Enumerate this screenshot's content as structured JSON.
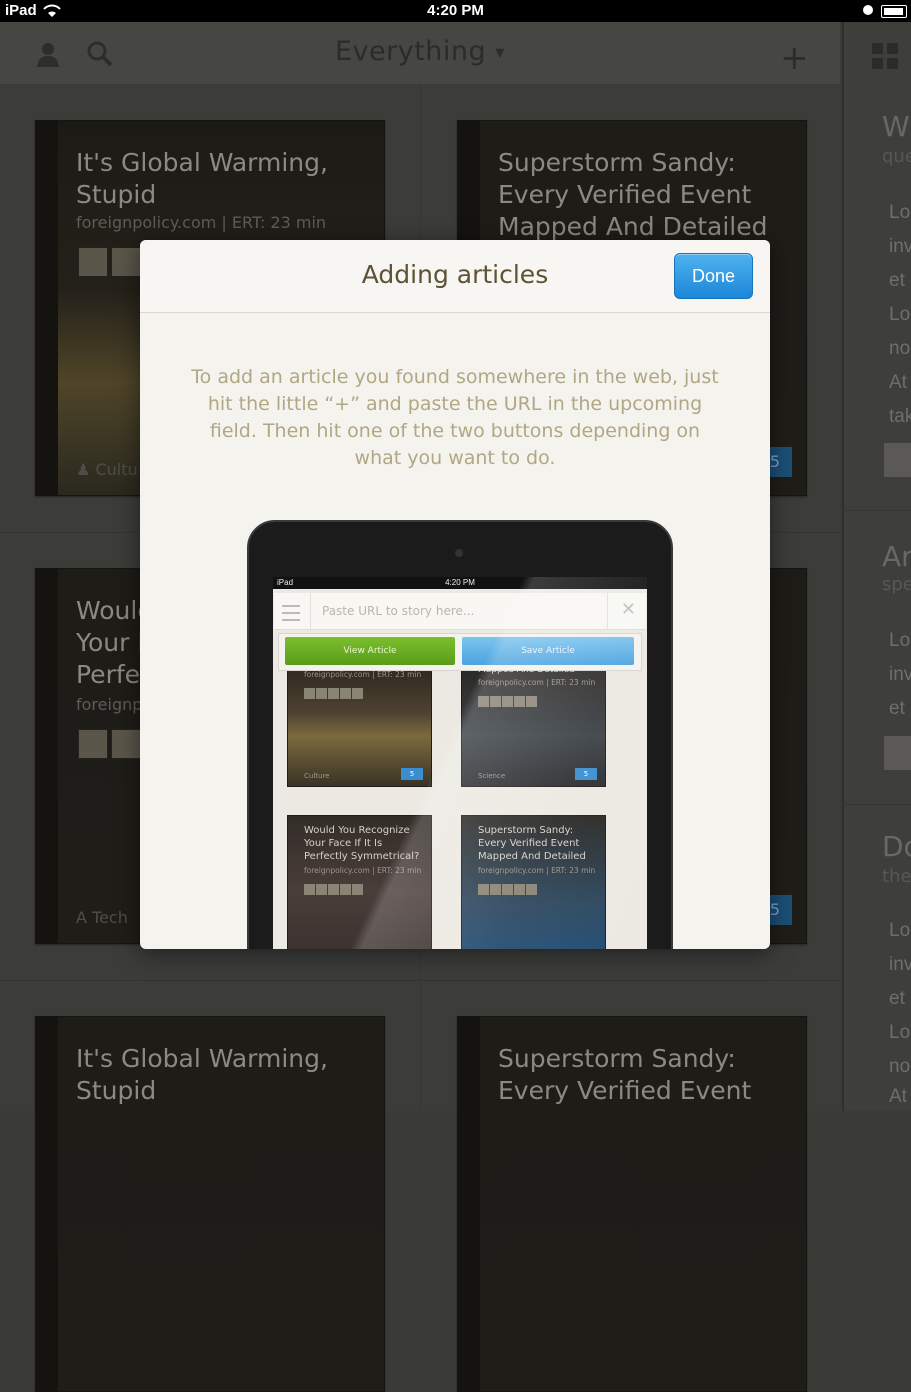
{
  "status_bar": {
    "carrier": "iPad",
    "time": "4:20 PM"
  },
  "top_bar": {
    "title": "Everything"
  },
  "feed": {
    "cards": [
      {
        "title": "It's Global Warming, Stupid",
        "source": "foreignpolicy.com | ERT: 23 min",
        "category": "Cultu"
      },
      {
        "title": "Superstorm Sandy: Every Verified Event Mapped And Detailed",
        "badge": "5"
      },
      {
        "title": "Would Your I Perfe",
        "source": "foreignp",
        "category": "Tech"
      },
      {
        "badge": "5"
      },
      {
        "title": "It's Global Warming, Stupid"
      },
      {
        "title": "Superstorm Sandy: Every Verified Event"
      }
    ]
  },
  "side_panel": {
    "items": [
      {
        "heading": "W",
        "sub": "que",
        "lines": [
          "Lo",
          "inv",
          "et",
          "Lo",
          "no",
          "At",
          "tak"
        ]
      },
      {
        "heading": "Ar",
        "sub": "spe",
        "lines": [
          "Lo",
          "inv",
          "et"
        ]
      },
      {
        "heading": "Do",
        "sub": "the",
        "lines": [
          "Lo",
          "inv",
          "et",
          "Lo",
          "no",
          "At"
        ]
      }
    ]
  },
  "modal": {
    "title": "Adding articles",
    "done_label": "Done",
    "instructions": "To add an article you found somewhere in the web, just hit the little “+” and paste the URL in the upcoming field. Then hit one of the two buttons depending on what you want to do."
  },
  "illustration": {
    "status": {
      "carrier": "iPad",
      "time": "4:20 PM"
    },
    "url_placeholder": "Paste URL to story here...",
    "view_label": "View Article",
    "save_label": "Save Article",
    "cards": [
      {
        "source": "foreignpolicy.com | ERT: 23 min",
        "category": "Culture",
        "badge": "5"
      },
      {
        "title": "Mapped And Detailed",
        "source": "foreignpolicy.com | ERT: 23 min",
        "category": "Science",
        "badge": "5"
      },
      {
        "title": "Would You Recognize Your Face If It Is Perfectly Symmetrical?",
        "source": "foreignpolicy.com | ERT: 23 min"
      },
      {
        "title": "Superstorm Sandy: Every Verified Event Mapped And Detailed",
        "source": "foreignpolicy.com | ERT: 23 min"
      }
    ]
  }
}
